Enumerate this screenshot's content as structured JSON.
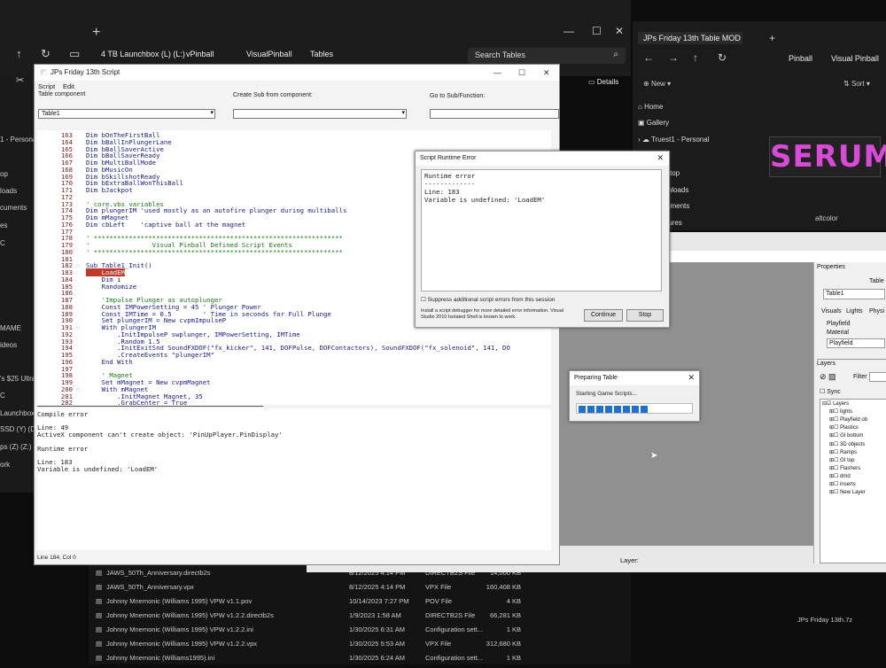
{
  "explorer_left": {
    "breadcrumb": [
      "4 TB Launchbox (L) (L:)",
      "vPinball",
      "VisualPinball",
      "Tables"
    ],
    "search_placeholder": "Search Tables",
    "details": "Details",
    "sidebar": [
      "1 - Personal",
      "op",
      "loads",
      "cuments",
      "es",
      "C",
      "MAME",
      "ideos",
      "'s $25 Ultra",
      "C",
      "Launchbox (L",
      "SSD (Y) (D:",
      "ps (Z) (Z:)",
      "ork"
    ]
  },
  "explorer_right": {
    "tab": "JPs Friday 13th Table MOD and",
    "breadcrumb": [
      "Pinball",
      "Visual Pinball"
    ],
    "new": "New",
    "sort": "Sort",
    "sidebar": [
      "Home",
      "Gallery",
      "Truest1 - Personal",
      "sktop",
      "wnloads",
      "cuments",
      "ctures"
    ],
    "thumb_label": "SERUM",
    "thumb_caption": "altcolor",
    "bottom_file": "JPs Friday 13th.7z"
  },
  "files": [
    {
      "name": "JAWS_50Th_Anniversary.directb2s",
      "date": "8/12/2025 4:14 PM",
      "type": "DIRECTB2S File",
      "size": "14,000 KB"
    },
    {
      "name": "JAWS_50Th_Anniversary.vpx",
      "date": "8/12/2025 4:14 PM",
      "type": "VPX File",
      "size": "160,408 KB"
    },
    {
      "name": "Johnny Mnemonic (Williams 1995) VPW v1.1.pov",
      "date": "10/14/2023 7:27 PM",
      "type": "POV File",
      "size": "4 KB"
    },
    {
      "name": "Johnny Mnemonic (Williams 1995) VPW v1.2.2.directb2s",
      "date": "1/9/2023 1:58 AM",
      "type": "DIRECTB2S File",
      "size": "66,281 KB"
    },
    {
      "name": "Johnny Mnemonic (Williams 1995) VPW v1.2.2.ini",
      "date": "1/30/2025 6:31 AM",
      "type": "Configuration sett...",
      "size": "1 KB"
    },
    {
      "name": "Johnny Mnemonic (Williams 1995) VPW v1.2.2.vpx",
      "date": "1/30/2025 5:53 AM",
      "type": "VPX File",
      "size": "312,680 KB"
    },
    {
      "name": "Johnny Mnemonic (Williams1995).ini",
      "date": "1/30/2025 6:24 AM",
      "type": "Configuration sett...",
      "size": "1 KB"
    }
  ],
  "script": {
    "title": "JPs Friday 13th Script",
    "menu": [
      "Script",
      "Edit"
    ],
    "labels": [
      "Table component",
      "Create Sub from component:",
      "Go to Sub/Function:"
    ],
    "combo1": "Table1",
    "lines": [
      [
        "163",
        "Dim bOnTheFirstBall"
      ],
      [
        "164",
        "Dim bBallInPlungerLane"
      ],
      [
        "165",
        "Dim bBallSaverActive"
      ],
      [
        "166",
        "Dim bBallSaverReady"
      ],
      [
        "167",
        "Dim bMultiBallMode"
      ],
      [
        "168",
        "Dim bMusicOn"
      ],
      [
        "169",
        "Dim bSkillshotReady"
      ],
      [
        "170",
        "Dim bExtraBallWonThisBall"
      ],
      [
        "171",
        "Dim bJackpot"
      ],
      [
        "172",
        ""
      ],
      [
        "173",
        "' core.vbs variables"
      ],
      [
        "174",
        "Dim plungerIM 'used mostly as an autofire plunger during multiballs"
      ],
      [
        "175",
        "Dim mMagnet"
      ],
      [
        "176",
        "Dim cbLeft    'captive ball at the magnet"
      ],
      [
        "177",
        ""
      ],
      [
        "178",
        "' ****************************************************************"
      ],
      [
        "179",
        "'                Visual Pinball Defined Script Events"
      ],
      [
        "180",
        "' ****************************************************************"
      ],
      [
        "181",
        ""
      ],
      [
        "182",
        "Sub Table1_Init()"
      ],
      [
        "183",
        "    LoadEM"
      ],
      [
        "184",
        "    Dim i"
      ],
      [
        "185",
        "    Randomize"
      ],
      [
        "186",
        ""
      ],
      [
        "187",
        "    'Impulse Plunger as autoplunger"
      ],
      [
        "188",
        "    Const IMPowerSetting = 45 ' Plunger Power"
      ],
      [
        "189",
        "    Const IMTime = 0.5        ' Time in seconds for Full Plunge"
      ],
      [
        "190",
        "    Set plungerIM = New cvpmImpulseP"
      ],
      [
        "191",
        "    With plungerIM"
      ],
      [
        "192",
        "        .InitImpulseP swplunger, IMPowerSetting, IMTime"
      ],
      [
        "193",
        "        .Random 1.5"
      ],
      [
        "194",
        "        .InitExitSnd SoundFXDOF(\"fx_kicker\", 141, DOFPulse, DOFContactors), SoundFXDOF(\"fx_solenoid\", 141, DO"
      ],
      [
        "195",
        "        .CreateEvents \"plungerIM\""
      ],
      [
        "196",
        "    End With"
      ],
      [
        "197",
        ""
      ],
      [
        "198",
        "    ' Magnet"
      ],
      [
        "199",
        "    Set mMagnet = New cvpmMagnet"
      ],
      [
        "200",
        "    With mMagnet"
      ],
      [
        "201",
        "        .InitMagnet Magnet, 35"
      ],
      [
        "202",
        "        .GrabCenter = True"
      ]
    ],
    "output": [
      "Compile error",
      "",
      "Line: 49",
      "ActiveX component can't create object: 'PinUpPlayer.PinDisplay'",
      "",
      "Runtime error",
      "",
      "Line: 183",
      "Variable is undefined: 'LoadEM'"
    ],
    "status": "Line 184, Col 0"
  },
  "runtime_dialog": {
    "title": "Script Runtime Error",
    "text": [
      "Runtime error",
      "-------------",
      "Line: 183",
      "Variable is undefined: 'LoadEM'"
    ],
    "checkbox": "Suppress additional script errors from this session",
    "note": "Install a script debugger for more detailed error information. Visual Studio 2010 Isolated Shell is known to work.",
    "continue": "Continue",
    "stop": "Stop"
  },
  "preparing": {
    "title": "Preparing Table",
    "text": "Starting Game Scripts...",
    "progress": 0.62
  },
  "props": {
    "title": "Properties",
    "table": "Table",
    "field": "Table1",
    "tabs": [
      "Visuals",
      "Lights",
      "Physi"
    ],
    "playfield": "Playfield",
    "material": "Material",
    "material_val": "Playfield",
    "layers": "Layers",
    "filter": "Filter",
    "sync": "Sync",
    "layer_items": [
      "Layers",
      "lights",
      "Playfield ob",
      "Plastics",
      "GI bottom",
      "3D objects",
      "Ramps",
      "GI top",
      "Flashers",
      "dmd",
      "inserts",
      "New Layer"
    ],
    "layer_label": "Layer:"
  }
}
